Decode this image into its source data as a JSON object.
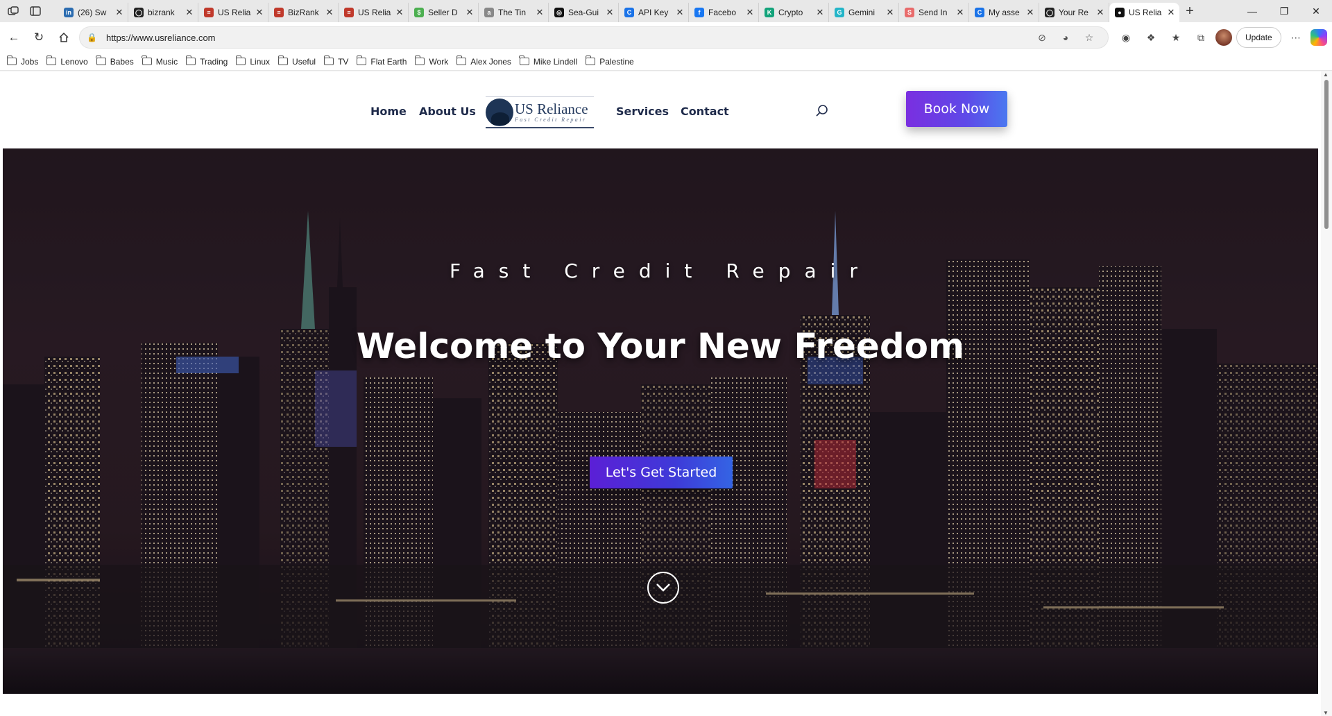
{
  "browser": {
    "tabs": [
      {
        "title": "(26) Sw",
        "fav_color": "#2b6cb0",
        "fav_glyph": "in"
      },
      {
        "title": "bizrank",
        "fav_color": "#222222",
        "fav_glyph": "◯"
      },
      {
        "title": "US Relia",
        "fav_color": "#c0392b",
        "fav_glyph": "≡"
      },
      {
        "title": "BizRank",
        "fav_color": "#c0392b",
        "fav_glyph": "≡"
      },
      {
        "title": "US Relia",
        "fav_color": "#c0392b",
        "fav_glyph": "≡"
      },
      {
        "title": "Seller D",
        "fav_color": "#4caf50",
        "fav_glyph": "$"
      },
      {
        "title": "The Tin",
        "fav_color": "#888888",
        "fav_glyph": "a"
      },
      {
        "title": "Sea-Gui",
        "fav_color": "#111111",
        "fav_glyph": "◎"
      },
      {
        "title": "API Key",
        "fav_color": "#1a73e8",
        "fav_glyph": "C"
      },
      {
        "title": "Facebo",
        "fav_color": "#1877f2",
        "fav_glyph": "f"
      },
      {
        "title": "Crypto",
        "fav_color": "#12a37a",
        "fav_glyph": "K"
      },
      {
        "title": "Gemini",
        "fav_color": "#23b5c8",
        "fav_glyph": "G"
      },
      {
        "title": "Send In",
        "fav_color": "#e86b6b",
        "fav_glyph": "S"
      },
      {
        "title": "My asse",
        "fav_color": "#1a73e8",
        "fav_glyph": "C"
      },
      {
        "title": "Your Re",
        "fav_color": "#222222",
        "fav_glyph": "◯"
      },
      {
        "title": "US Relia",
        "fav_color": "#111111",
        "fav_glyph": "●",
        "active": true
      }
    ],
    "url": "https://www.usreliance.com",
    "update_label": "Update",
    "bookmarks": [
      "Jobs",
      "Lenovo",
      "Babes",
      "Music",
      "Trading",
      "Linux",
      "Useful",
      "TV",
      "Flat Earth",
      "Work",
      "Alex Jones",
      "Mike Lindell",
      "Palestine"
    ]
  },
  "site": {
    "nav": {
      "home": "Home",
      "about": "About Us",
      "services": "Services",
      "contact": "Contact"
    },
    "logo": {
      "name": "US Reliance",
      "tagline": "Fast Credit Repair"
    },
    "book_button": "Book Now",
    "hero": {
      "eyebrow": "Fast Credit Repair",
      "title": "Welcome to Your New Freedom",
      "cta": "Let's Get Started"
    },
    "colors": {
      "nav_text": "#1e2a4a",
      "button_purple": "#7a2fe0",
      "button_blue": "#4a78f0"
    }
  }
}
